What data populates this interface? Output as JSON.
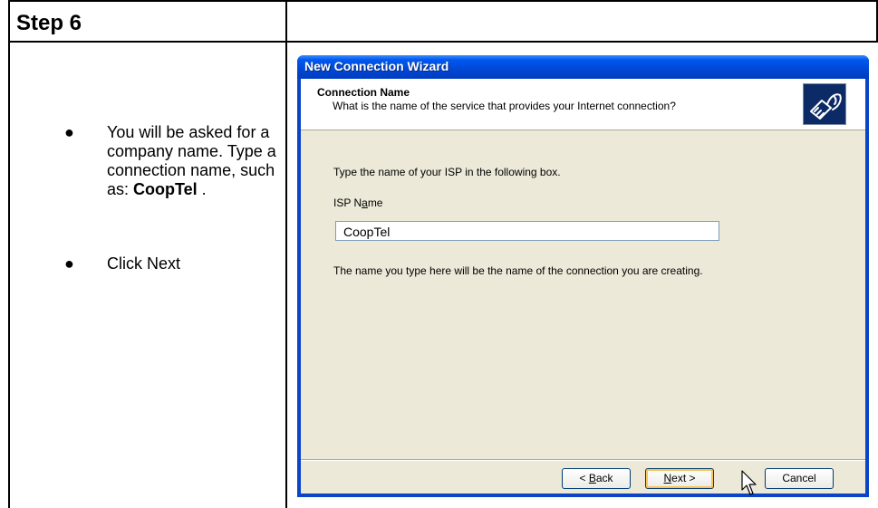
{
  "document": {
    "step_title": "Step 6",
    "bullets": [
      {
        "text_pre": "You will be asked for a company name. Type a connection name, such as: ",
        "text_bold": "CoopTel",
        "text_post": " ."
      },
      {
        "text_pre": "Click Next",
        "text_bold": "",
        "text_post": ""
      }
    ]
  },
  "wizard": {
    "window_title": "New Connection Wizard",
    "header": {
      "title": "Connection Name",
      "subtitle": "What is the name of the service that provides your Internet connection?",
      "icon": "network-cable-icon"
    },
    "instruction": "Type the name of your ISP in the following box.",
    "isp_label": "ISP Name",
    "isp_value": "CoopTel",
    "note": "The name you type here will be the name of the connection you are creating.",
    "buttons": {
      "back": "< Back",
      "next": "Next >",
      "cancel": "Cancel"
    }
  },
  "colors": {
    "titlebar": "#0058EE",
    "client_bg": "#ECE9D8",
    "focus_ring": "#F7C35A"
  }
}
